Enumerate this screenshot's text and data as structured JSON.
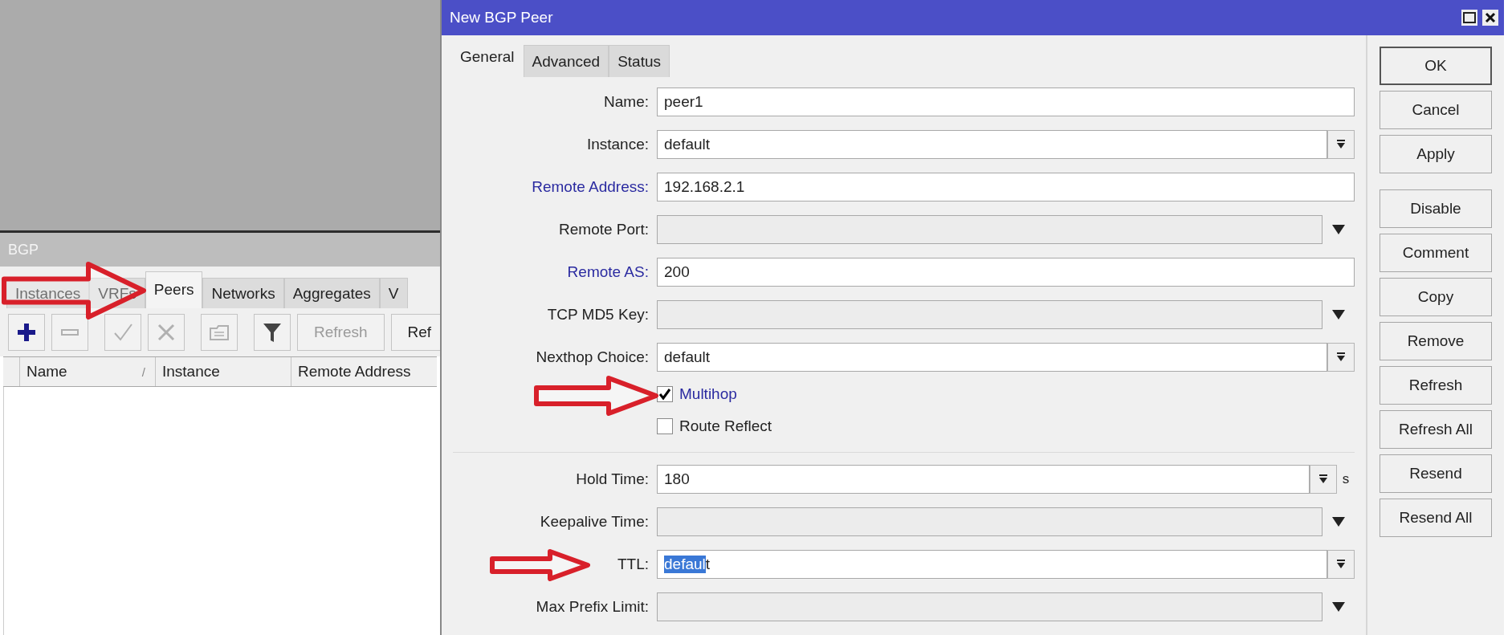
{
  "bgp_window": {
    "title": "BGP",
    "tabs": [
      {
        "label": "Instances",
        "selected": false
      },
      {
        "label": "VRFs",
        "selected": false
      },
      {
        "label": "Peers",
        "selected": true
      },
      {
        "label": "Networks",
        "selected": false
      },
      {
        "label": "Aggregates",
        "selected": false
      },
      {
        "label": "V",
        "selected": false
      }
    ],
    "toolbar": [
      {
        "kind": "add",
        "disabled": false
      },
      {
        "kind": "remove",
        "disabled": true
      },
      {
        "kind": "enable",
        "disabled": true
      },
      {
        "kind": "disable",
        "disabled": true
      },
      {
        "kind": "comment",
        "disabled": true
      },
      {
        "kind": "filter",
        "disabled": false
      },
      {
        "kind": "text",
        "label": "Refresh",
        "disabled": true
      },
      {
        "kind": "text",
        "label": "Ref",
        "disabled": false
      }
    ],
    "table": {
      "columns": [
        {
          "label": "Name",
          "sort_mark": "/"
        },
        {
          "label": "Instance"
        },
        {
          "label": "Remote Address"
        }
      ]
    }
  },
  "dialog": {
    "title": "New BGP Peer",
    "tabs": [
      {
        "label": "General",
        "selected": true
      },
      {
        "label": "Advanced",
        "selected": false
      },
      {
        "label": "Status",
        "selected": false
      }
    ],
    "fields": [
      {
        "kind": "text",
        "label": "Name:",
        "value": "peer1",
        "required": false
      },
      {
        "kind": "combo",
        "label": "Instance:",
        "value": "default",
        "required": false
      },
      {
        "kind": "text",
        "label": "Remote Address:",
        "value": "192.168.2.1",
        "required": true
      },
      {
        "kind": "dropdown",
        "label": "Remote Port:",
        "required": false
      },
      {
        "kind": "text",
        "label": "Remote AS:",
        "value": "200",
        "required": true
      },
      {
        "kind": "dropdown",
        "label": "TCP MD5 Key:",
        "required": false
      },
      {
        "kind": "combo",
        "label": "Nexthop Choice:",
        "value": "default",
        "required": false
      },
      {
        "kind": "checkbox",
        "label": "Multihop",
        "checked": true,
        "required": true
      },
      {
        "kind": "checkbox",
        "label": "Route Reflect",
        "checked": false,
        "required": false
      },
      {
        "kind": "separator"
      },
      {
        "kind": "combo",
        "label": "Hold Time:",
        "value": "180",
        "unit": "s",
        "required": false
      },
      {
        "kind": "dropdown",
        "label": "Keepalive Time:",
        "required": false
      },
      {
        "kind": "combo",
        "label": "TTL:",
        "value_selected": "defaul",
        "value_rest": "t",
        "required": false
      },
      {
        "kind": "dropdown",
        "label": "Max Prefix Limit:",
        "required": false
      }
    ],
    "button_groups": [
      {
        "buttons": [
          {
            "label": "OK",
            "default": true
          },
          {
            "label": "Cancel",
            "default": false
          },
          {
            "label": "Apply",
            "default": false
          }
        ]
      },
      {
        "buttons": [
          {
            "label": "Disable",
            "default": false
          },
          {
            "label": "Comment",
            "default": false
          },
          {
            "label": "Copy",
            "default": false
          },
          {
            "label": "Remove",
            "default": false
          },
          {
            "label": "Refresh",
            "default": false
          },
          {
            "label": "Refresh All",
            "default": false
          },
          {
            "label": "Resend",
            "default": false
          },
          {
            "label": "Resend All",
            "default": false
          }
        ]
      }
    ]
  }
}
